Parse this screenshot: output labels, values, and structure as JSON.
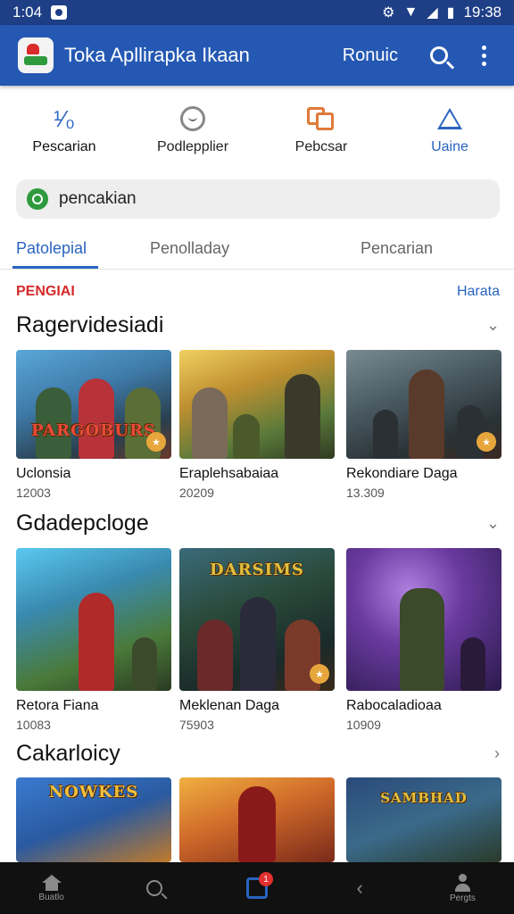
{
  "status_bar": {
    "time": "1:04",
    "right_time": "19:38"
  },
  "app_bar": {
    "title": "Toka Apllirapka Ikaan",
    "action_label": "Ronuic"
  },
  "categories": [
    {
      "label": "Pescarian",
      "icon": "chart-icon",
      "glyph": "¹⁄₀"
    },
    {
      "label": "Podlepplier",
      "icon": "face-icon"
    },
    {
      "label": "Pebcsar",
      "icon": "boxes-icon"
    },
    {
      "label": "Uaine",
      "icon": "bell-icon"
    }
  ],
  "search": {
    "value": "pencakian"
  },
  "tabs": [
    "Patolepial",
    "Penolladay",
    "Pencarian"
  ],
  "promo": {
    "left": "PENGIAI",
    "right": "Harata"
  },
  "sections": [
    {
      "title": "Ragervidesiadi",
      "items": [
        {
          "title": "Uclonsia",
          "count": "12003",
          "banner": "PARGOBURS"
        },
        {
          "title": "Eraplehsabaiaa",
          "count": "20209"
        },
        {
          "title": "Rekondiare Daga",
          "count": "13.309"
        }
      ]
    },
    {
      "title": "Gdadepcloge",
      "items": [
        {
          "title": "Retora Fiana",
          "count": "10083"
        },
        {
          "title": "Meklenan Daga",
          "count": "75903",
          "banner": "DARSIMS"
        },
        {
          "title": "Rabocaladioaa",
          "count": "10909"
        }
      ]
    },
    {
      "title": "Cakarloicy",
      "items": [
        {
          "banner": "NOWKES"
        },
        {},
        {
          "banner": "SAMBHAD"
        }
      ]
    }
  ],
  "bottom_nav": {
    "home": "Buatlo",
    "profile": "Pergts",
    "notif_count": "1"
  },
  "colors": {
    "app_bar": "#2458b3",
    "status_bar": "#1e3f86",
    "accent": "#2a64c0",
    "promo_red": "#d62a2a"
  }
}
